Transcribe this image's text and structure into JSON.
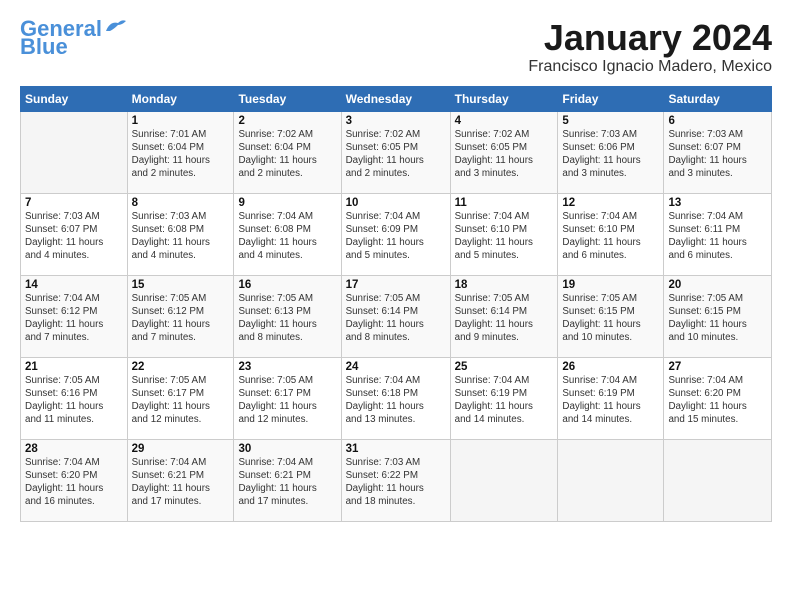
{
  "header": {
    "logo_line1": "General",
    "logo_line2": "Blue",
    "title": "January 2024",
    "subtitle": "Francisco Ignacio Madero, Mexico"
  },
  "days_of_week": [
    "Sunday",
    "Monday",
    "Tuesday",
    "Wednesday",
    "Thursday",
    "Friday",
    "Saturday"
  ],
  "weeks": [
    [
      {
        "num": "",
        "info": ""
      },
      {
        "num": "1",
        "info": "Sunrise: 7:01 AM\nSunset: 6:04 PM\nDaylight: 11 hours\nand 2 minutes."
      },
      {
        "num": "2",
        "info": "Sunrise: 7:02 AM\nSunset: 6:04 PM\nDaylight: 11 hours\nand 2 minutes."
      },
      {
        "num": "3",
        "info": "Sunrise: 7:02 AM\nSunset: 6:05 PM\nDaylight: 11 hours\nand 2 minutes."
      },
      {
        "num": "4",
        "info": "Sunrise: 7:02 AM\nSunset: 6:05 PM\nDaylight: 11 hours\nand 3 minutes."
      },
      {
        "num": "5",
        "info": "Sunrise: 7:03 AM\nSunset: 6:06 PM\nDaylight: 11 hours\nand 3 minutes."
      },
      {
        "num": "6",
        "info": "Sunrise: 7:03 AM\nSunset: 6:07 PM\nDaylight: 11 hours\nand 3 minutes."
      }
    ],
    [
      {
        "num": "7",
        "info": "Sunrise: 7:03 AM\nSunset: 6:07 PM\nDaylight: 11 hours\nand 4 minutes."
      },
      {
        "num": "8",
        "info": "Sunrise: 7:03 AM\nSunset: 6:08 PM\nDaylight: 11 hours\nand 4 minutes."
      },
      {
        "num": "9",
        "info": "Sunrise: 7:04 AM\nSunset: 6:08 PM\nDaylight: 11 hours\nand 4 minutes."
      },
      {
        "num": "10",
        "info": "Sunrise: 7:04 AM\nSunset: 6:09 PM\nDaylight: 11 hours\nand 5 minutes."
      },
      {
        "num": "11",
        "info": "Sunrise: 7:04 AM\nSunset: 6:10 PM\nDaylight: 11 hours\nand 5 minutes."
      },
      {
        "num": "12",
        "info": "Sunrise: 7:04 AM\nSunset: 6:10 PM\nDaylight: 11 hours\nand 6 minutes."
      },
      {
        "num": "13",
        "info": "Sunrise: 7:04 AM\nSunset: 6:11 PM\nDaylight: 11 hours\nand 6 minutes."
      }
    ],
    [
      {
        "num": "14",
        "info": "Sunrise: 7:04 AM\nSunset: 6:12 PM\nDaylight: 11 hours\nand 7 minutes."
      },
      {
        "num": "15",
        "info": "Sunrise: 7:05 AM\nSunset: 6:12 PM\nDaylight: 11 hours\nand 7 minutes."
      },
      {
        "num": "16",
        "info": "Sunrise: 7:05 AM\nSunset: 6:13 PM\nDaylight: 11 hours\nand 8 minutes."
      },
      {
        "num": "17",
        "info": "Sunrise: 7:05 AM\nSunset: 6:14 PM\nDaylight: 11 hours\nand 8 minutes."
      },
      {
        "num": "18",
        "info": "Sunrise: 7:05 AM\nSunset: 6:14 PM\nDaylight: 11 hours\nand 9 minutes."
      },
      {
        "num": "19",
        "info": "Sunrise: 7:05 AM\nSunset: 6:15 PM\nDaylight: 11 hours\nand 10 minutes."
      },
      {
        "num": "20",
        "info": "Sunrise: 7:05 AM\nSunset: 6:15 PM\nDaylight: 11 hours\nand 10 minutes."
      }
    ],
    [
      {
        "num": "21",
        "info": "Sunrise: 7:05 AM\nSunset: 6:16 PM\nDaylight: 11 hours\nand 11 minutes."
      },
      {
        "num": "22",
        "info": "Sunrise: 7:05 AM\nSunset: 6:17 PM\nDaylight: 11 hours\nand 12 minutes."
      },
      {
        "num": "23",
        "info": "Sunrise: 7:05 AM\nSunset: 6:17 PM\nDaylight: 11 hours\nand 12 minutes."
      },
      {
        "num": "24",
        "info": "Sunrise: 7:04 AM\nSunset: 6:18 PM\nDaylight: 11 hours\nand 13 minutes."
      },
      {
        "num": "25",
        "info": "Sunrise: 7:04 AM\nSunset: 6:19 PM\nDaylight: 11 hours\nand 14 minutes."
      },
      {
        "num": "26",
        "info": "Sunrise: 7:04 AM\nSunset: 6:19 PM\nDaylight: 11 hours\nand 14 minutes."
      },
      {
        "num": "27",
        "info": "Sunrise: 7:04 AM\nSunset: 6:20 PM\nDaylight: 11 hours\nand 15 minutes."
      }
    ],
    [
      {
        "num": "28",
        "info": "Sunrise: 7:04 AM\nSunset: 6:20 PM\nDaylight: 11 hours\nand 16 minutes."
      },
      {
        "num": "29",
        "info": "Sunrise: 7:04 AM\nSunset: 6:21 PM\nDaylight: 11 hours\nand 17 minutes."
      },
      {
        "num": "30",
        "info": "Sunrise: 7:04 AM\nSunset: 6:21 PM\nDaylight: 11 hours\nand 17 minutes."
      },
      {
        "num": "31",
        "info": "Sunrise: 7:03 AM\nSunset: 6:22 PM\nDaylight: 11 hours\nand 18 minutes."
      },
      {
        "num": "",
        "info": ""
      },
      {
        "num": "",
        "info": ""
      },
      {
        "num": "",
        "info": ""
      }
    ]
  ]
}
